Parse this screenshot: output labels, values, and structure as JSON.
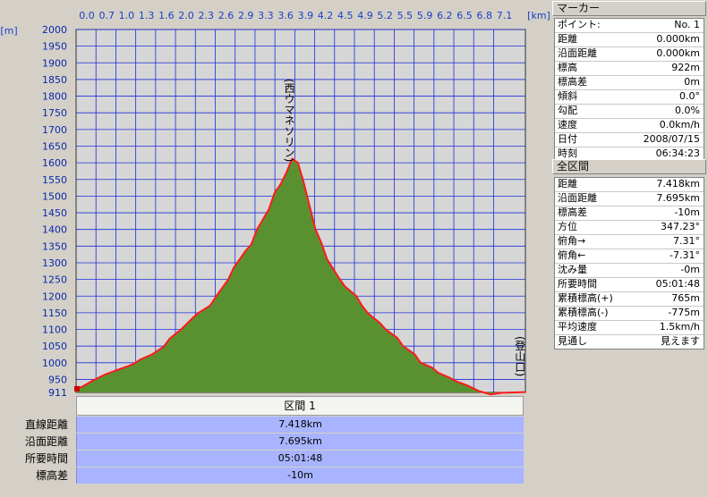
{
  "chart_data": {
    "type": "area",
    "xunit": "[km]",
    "yunit": "[m]",
    "x_ticks": [
      "0.0",
      "0.7",
      "1.0",
      "1.3",
      "1.6",
      "2.0",
      "2.3",
      "2.6",
      "2.9",
      "3.3",
      "3.6",
      "3.9",
      "4.2",
      "4.5",
      "4.9",
      "5.2",
      "5.5",
      "5.9",
      "6.2",
      "6.5",
      "6.8",
      "7.1"
    ],
    "y_ticks": [
      911,
      950,
      1000,
      1050,
      1100,
      1150,
      1200,
      1250,
      1300,
      1350,
      1400,
      1450,
      1500,
      1550,
      1600,
      1650,
      1700,
      1750,
      1800,
      1850,
      1900,
      1950,
      2000
    ],
    "ylim": [
      911,
      2000
    ],
    "xlim": [
      0,
      7.695
    ],
    "x": [
      0.0,
      0.1,
      0.3,
      0.5,
      0.7,
      0.9,
      1.0,
      1.1,
      1.3,
      1.5,
      1.6,
      1.8,
      2.0,
      2.1,
      2.3,
      2.4,
      2.6,
      2.7,
      2.9,
      3.0,
      3.1,
      3.3,
      3.4,
      3.5,
      3.6,
      3.7,
      3.8,
      3.9,
      4.0,
      4.1,
      4.2,
      4.3,
      4.5,
      4.6,
      4.8,
      4.9,
      5.0,
      5.2,
      5.3,
      5.5,
      5.6,
      5.8,
      5.9,
      6.1,
      6.2,
      6.4,
      6.5,
      6.7,
      6.9,
      7.1,
      7.3,
      7.5,
      7.695
    ],
    "values": [
      922,
      928,
      948,
      965,
      978,
      990,
      998,
      1010,
      1025,
      1048,
      1072,
      1100,
      1135,
      1150,
      1172,
      1200,
      1248,
      1285,
      1335,
      1355,
      1400,
      1460,
      1510,
      1535,
      1570,
      1612,
      1600,
      1540,
      1470,
      1400,
      1360,
      1310,
      1255,
      1230,
      1200,
      1170,
      1148,
      1120,
      1100,
      1075,
      1050,
      1025,
      1000,
      985,
      970,
      955,
      945,
      932,
      915,
      905,
      910,
      911,
      912
    ],
    "annotations": [
      {
        "label": "(西ウマネソリン)",
        "x": 3.65
      },
      {
        "label": "(登山口)",
        "x": 7.6
      }
    ],
    "grid": true
  },
  "section_label": "区間 1",
  "summary": [
    {
      "label": "直線距離",
      "value": "7.418km"
    },
    {
      "label": "沿面距離",
      "value": "7.695km"
    },
    {
      "label": "所要時間",
      "value": "05:01:48"
    },
    {
      "label": "標高差",
      "value": "-10m"
    }
  ],
  "marker": {
    "title": "マーカー",
    "rows": [
      {
        "k": "ポイント:",
        "v": "No. 1"
      },
      {
        "k": "距離",
        "v": "0.000km"
      },
      {
        "k": "沿面距離",
        "v": "0.000km"
      },
      {
        "k": "標高",
        "v": "922m"
      },
      {
        "k": "標高差",
        "v": "0m"
      },
      {
        "k": "傾斜",
        "v": "0.0°"
      },
      {
        "k": "勾配",
        "v": "0.0%"
      },
      {
        "k": "速度",
        "v": "0.0km/h"
      },
      {
        "k": "日付",
        "v": "2008/07/15"
      },
      {
        "k": "時刻",
        "v": "06:34:23"
      }
    ]
  },
  "all_section": {
    "title": "全区間",
    "rows": [
      {
        "k": "距離",
        "v": "7.418km"
      },
      {
        "k": "沿面距離",
        "v": "7.695km"
      },
      {
        "k": "標高差",
        "v": "-10m"
      },
      {
        "k": "方位",
        "v": "347.23°"
      },
      {
        "k": "俯角→",
        "v": "7.31°"
      },
      {
        "k": "俯角←",
        "v": "-7.31°"
      },
      {
        "k": "沈み量",
        "v": "-0m"
      },
      {
        "k": "所要時間",
        "v": "05:01:48"
      },
      {
        "k": "累積標高(+)",
        "v": "765m"
      },
      {
        "k": "累積標高(-)",
        "v": "-775m"
      },
      {
        "k": "平均速度",
        "v": "1.5km/h"
      },
      {
        "k": "見通し",
        "v": "見えます"
      }
    ]
  },
  "colors": {
    "fill": "#5a9130",
    "line": "#ff1a1a",
    "grid": "#1c2fd8",
    "bg": "#d6d6d6"
  }
}
